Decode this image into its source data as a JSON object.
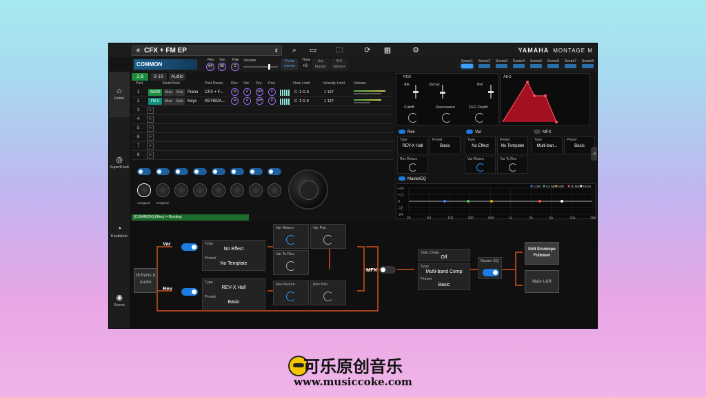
{
  "app": {
    "preset_title": "CFX + FM EP",
    "brand": "YAMAHA",
    "model": "MONTAGE M"
  },
  "icons": {
    "star": "star-icon",
    "search": "search-icon",
    "screen": "monitor-icon",
    "folder": "folder-icon",
    "sync": "sync-icon",
    "grid": "keyboard-grid-icon",
    "settings": "gear-icon"
  },
  "common": {
    "label": "COMMON",
    "rev_label": "Rev",
    "rev_value": "64",
    "var_label": "Var",
    "var_value": "96",
    "pan_label": "Pan",
    "pan_value": "C",
    "volume_label": "Volume",
    "porta_label_1": "Porta",
    "porta_label_2": "mento",
    "time_label": "Time",
    "time_value": "+0",
    "arp_label_1": "Arp",
    "arp_label_2": "Master",
    "ms_label_1": "MS",
    "ms_label_2": "Master"
  },
  "scenes": [
    "Scene1",
    "Scene2",
    "Scene3",
    "Scene4",
    "Scene5",
    "Scene6",
    "Scene7",
    "Scene8"
  ],
  "sidebar": [
    {
      "label": "Home",
      "icon": "home-icon"
    },
    {
      "label": "SuperKnob",
      "icon": "superknob-icon"
    },
    {
      "label": "KnobAuto",
      "icon": "knobauto-icon"
    },
    {
      "label": "Scene",
      "icon": "scene-icon"
    }
  ],
  "part_tabs": [
    "1-8",
    "9-16",
    "Audio"
  ],
  "part_headers": [
    "Part",
    "Mute/Solo",
    "Part Name",
    "Rev",
    "Var",
    "Dry",
    "Pan",
    "Note Limit",
    "Velocity Limit",
    "Volume"
  ],
  "parts": [
    {
      "num": "1",
      "tag": "AWM2",
      "mute": "Mute",
      "solo": "Solo",
      "cat": "Piano",
      "name": "CFX + F...",
      "rev": "12",
      "var": "0",
      "dry": "127",
      "pan": "C",
      "note": "C -2   G 8",
      "vel": "1      127"
    },
    {
      "num": "2",
      "tag": "FM-X",
      "mute": "Mute",
      "solo": "Solo",
      "cat": "Keys",
      "name": "KEYBOA...",
      "rev": "12",
      "var": "0",
      "dry": "127",
      "pan": "C",
      "note": "C -2   G 8",
      "vel": "1      127"
    }
  ],
  "empty_parts": [
    "3",
    "4",
    "5",
    "6",
    "7",
    "8"
  ],
  "knob_labels": [
    "Assigned",
    "Assigned"
  ],
  "feg": {
    "title": "FEG",
    "atk": "Atk",
    "decay": "Decay",
    "rel": "Rel",
    "cutoff": "Cutoff",
    "resonance": "Resonance",
    "depth": "FEG Depth"
  },
  "aeg": {
    "title": "AEG"
  },
  "effects": {
    "rev": {
      "title": "Rev",
      "type_label": "Type",
      "type": "REV-X Hall",
      "preset_label": "Preset",
      "preset": "Basic",
      "return_label": "Rev Return"
    },
    "var": {
      "title": "Var",
      "type_label": "Type",
      "type": "No Effect",
      "preset_label": "Preset",
      "preset": "No Template",
      "return_label": "Var Return",
      "to_rev_label": "Var To Rev"
    },
    "mfx": {
      "title": "MFX",
      "type_label": "Type",
      "type": "Multi-ban...",
      "preset_label": "Preset",
      "preset": "Basic"
    }
  },
  "master_eq": {
    "title": "MasterEQ",
    "bands": [
      "LOW",
      "LO MID",
      "MID",
      "HI MID",
      "HIGH"
    ],
    "band_colors": [
      "#2f8fff",
      "#3fcf5f",
      "#f0a020",
      "#ff4f4f",
      "#ffffff"
    ],
    "y_ticks": [
      "+24",
      "+12",
      "0",
      "-12",
      "-24"
    ],
    "x_ticks": [
      "20",
      "50",
      "100",
      "200",
      "500",
      "1k",
      "2k",
      "5k",
      "10k",
      "20k"
    ]
  },
  "routing": {
    "breadcrumb": "[COMMON] Effect > Routing",
    "source": "16 Parts & Audio",
    "var_label": "Var",
    "rev_label": "Rev",
    "var_type_label": "Type",
    "var_type": "No Effect",
    "var_preset_label": "Preset",
    "var_preset": "No Template",
    "rev_type_label": "Type",
    "rev_type": "REV-X Hall",
    "rev_preset_label": "Preset",
    "rev_preset": "Basic",
    "var_return": "Var Return",
    "var_pan": "Var Pan",
    "var_to_rev": "Var To Rev",
    "rev_return": "Rev Return",
    "rev_pan": "Rev Pan",
    "mfx_label": "MFX",
    "side_chain_label": "Side Chain",
    "side_chain": "Off",
    "mfx_type_label": "Type",
    "mfx_type": "Multi-band Comp",
    "mfx_preset_label": "Preset",
    "mfx_preset": "Basic",
    "master_eq_label": "Master EQ",
    "edit_env": "Edit Envelope Follower",
    "main_lr": "Main L&R"
  },
  "watermark": {
    "title": "可乐原创音乐",
    "url": "www.musiccoke.com"
  }
}
